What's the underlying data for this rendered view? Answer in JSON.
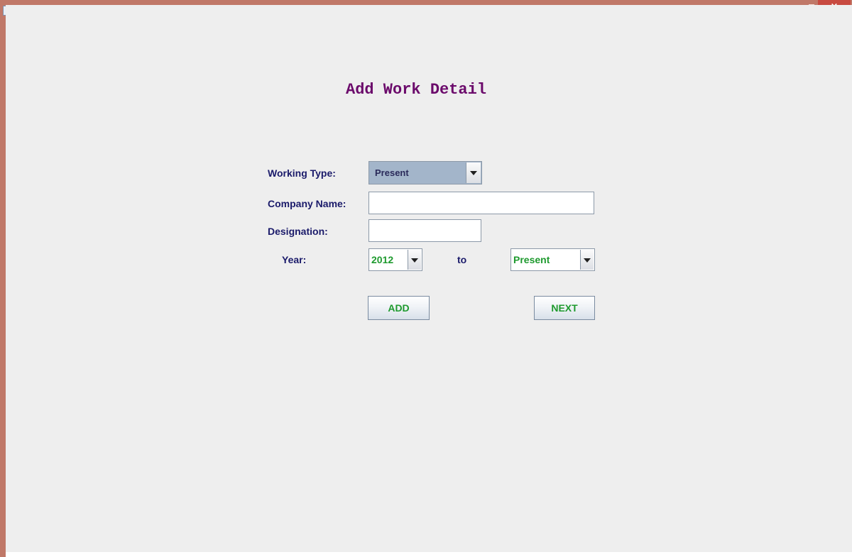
{
  "window": {
    "title": "",
    "controls": {
      "minimize_icon": "minimize-icon",
      "maximize_icon": "maximize-icon",
      "close_glyph": "×"
    }
  },
  "form": {
    "title": "Add Work Detail",
    "working_type": {
      "label": "Working Type:",
      "selected": "Present"
    },
    "company_name": {
      "label": "Company Name:",
      "value": ""
    },
    "designation": {
      "label": "Designation:",
      "value": ""
    },
    "year": {
      "label": "Year:",
      "from": "2012",
      "separator": "to",
      "to": "Present"
    },
    "buttons": {
      "add": "ADD",
      "next": "NEXT"
    }
  },
  "colors": {
    "title_bar": "#c07868",
    "close_button": "#c84a40",
    "panel_background": "#eeeeee",
    "title_text": "#6b0a6b",
    "label_text": "#1a1a6a",
    "value_text": "#1e9a2e",
    "working_type_background": "#a3b5ca"
  }
}
